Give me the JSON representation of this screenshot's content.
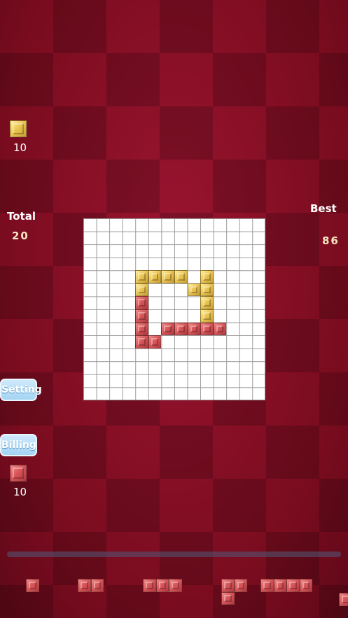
{
  "counters": {
    "yellow_count": "10",
    "red_count": "10"
  },
  "score": {
    "total_label": "Total",
    "total_value": "20",
    "best_label": "Best",
    "best_value": "86"
  },
  "buttons": {
    "setting": "Setting",
    "billing": "Billing"
  },
  "board": {
    "rows": 14,
    "cols": 14,
    "yellow_cells": [
      [
        4,
        4
      ],
      [
        4,
        5
      ],
      [
        4,
        6
      ],
      [
        4,
        7
      ],
      [
        4,
        9
      ],
      [
        5,
        4
      ],
      [
        5,
        8
      ],
      [
        5,
        9
      ],
      [
        6,
        9
      ],
      [
        7,
        9
      ]
    ],
    "red_cells": [
      [
        6,
        4
      ],
      [
        7,
        4
      ],
      [
        8,
        4
      ],
      [
        8,
        6
      ],
      [
        8,
        7
      ],
      [
        8,
        8
      ],
      [
        8,
        9
      ],
      [
        8,
        10
      ],
      [
        9,
        4
      ],
      [
        9,
        5
      ]
    ]
  },
  "colors": {
    "background": "#8a0f24",
    "red_block": "#d65357",
    "yellow_block": "#e8c24e",
    "button": "#a4d4f3"
  },
  "tray": {
    "pieces": [
      {
        "name": "single",
        "cells": [
          [
            0,
            0
          ]
        ]
      },
      {
        "name": "domino",
        "cells": [
          [
            0,
            0
          ],
          [
            0,
            1
          ]
        ]
      },
      {
        "name": "triomino-line",
        "cells": [
          [
            0,
            0
          ],
          [
            0,
            1
          ],
          [
            0,
            2
          ]
        ]
      },
      {
        "name": "l-triomino",
        "cells": [
          [
            0,
            0
          ],
          [
            0,
            1
          ],
          [
            1,
            0
          ]
        ]
      },
      {
        "name": "tetromino-line",
        "cells": [
          [
            0,
            0
          ],
          [
            0,
            1
          ],
          [
            0,
            2
          ],
          [
            0,
            3
          ]
        ]
      },
      {
        "name": "partial-piece",
        "cells": [
          [
            0,
            0
          ]
        ]
      }
    ]
  }
}
